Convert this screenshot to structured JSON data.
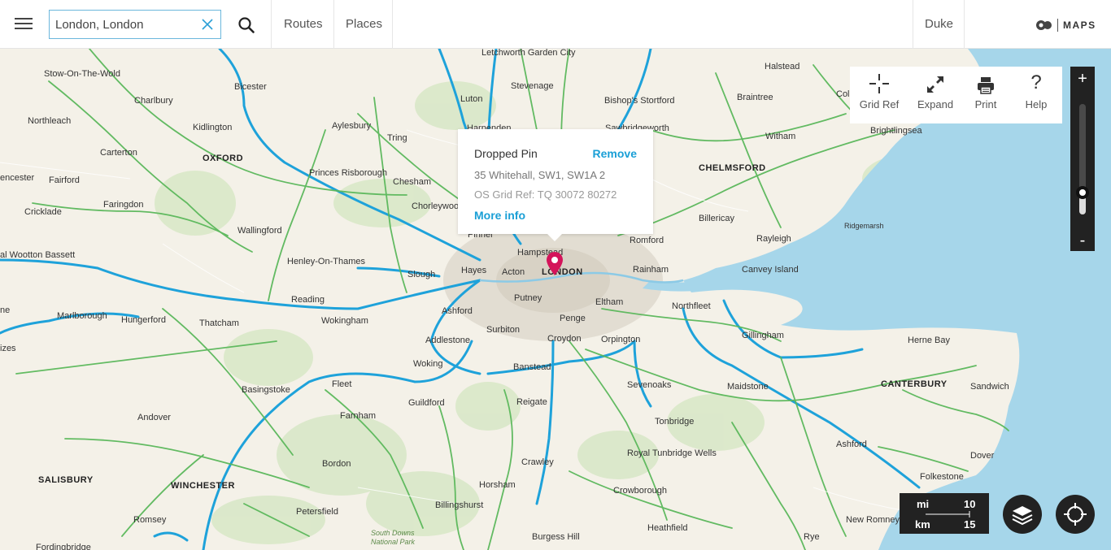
{
  "header": {
    "menu_icon": "hamburger-menu-icon",
    "search": {
      "value": "London, London",
      "clear_icon": "close-icon",
      "search_icon": "search-icon"
    },
    "nav": {
      "routes": "Routes",
      "places": "Places",
      "user": "Duke"
    },
    "logo": {
      "text": "MAPS",
      "icon": "os-logo-icon"
    }
  },
  "tools": [
    {
      "label": "Grid Ref",
      "icon": "crosshair-grid-icon"
    },
    {
      "label": "Expand",
      "icon": "expand-arrows-icon"
    },
    {
      "label": "Print",
      "icon": "printer-icon"
    },
    {
      "label": "Help",
      "icon": "question-mark-icon"
    }
  ],
  "zoom": {
    "in_label": "+",
    "out_label": "-",
    "level": 0.2
  },
  "popup": {
    "title": "Dropped Pin",
    "remove": "Remove",
    "address": "35 Whitehall, SW1, SW1A 2",
    "grid_ref": "OS Grid Ref: TQ 30072 80272",
    "more_info": "More info"
  },
  "scale": {
    "mi_label": "mi",
    "mi_value": "10",
    "km_label": "km",
    "km_value": "15"
  },
  "buttons": {
    "layers_icon": "layers-icon",
    "locate_icon": "locate-crosshair-icon"
  },
  "colors": {
    "accent": "#1a9fd6",
    "pin": "#d4145a",
    "motorway": "#1ea2da",
    "a_road": "#5bb85b",
    "sea": "#a6d6ea",
    "land": "#f4f1e8",
    "panel_dark": "#222222"
  },
  "map": {
    "places": [
      "Letchworth Garden City",
      "Stow-On-The-Wold",
      "Bicester",
      "Halstead",
      "Luton",
      "Stevenage",
      "Charlbury",
      "Bishop's Stortford",
      "Braintree",
      "Northleach",
      "Aylesbury",
      "Harpenden",
      "Sawbridgeworth",
      "Brightlingsea",
      "Kidlington",
      "Tring",
      "Witham",
      "Carterton",
      "OXFORD",
      "CHELMSFORD",
      "encester",
      "Fairford",
      "Princes Risborough",
      "Chesham",
      "Faringdon",
      "Chorleywood",
      "Cricklade",
      "Billericay",
      "Ridgemarsh",
      "Wallingford",
      "Pinner",
      "Romford",
      "Rayleigh",
      "al Wootton Bassett",
      "Hampstead",
      "Henley-On-Thames",
      "Hayes",
      "Acton",
      "LONDON",
      "Rainham",
      "Canvey Island",
      "Slough",
      "Reading",
      "Putney",
      "Eltham",
      "Northfleet",
      "ne",
      "Marlborough",
      "Hungerford",
      "Thatcham",
      "Wokingham",
      "Ashford",
      "Penge",
      "Surbiton",
      "Gillingham",
      "Addlestone",
      "Croydon",
      "Orpington",
      "Herne Bay",
      "izes",
      "Woking",
      "Banstead",
      "Sevenoaks",
      "Maidstone",
      "CANTERBURY",
      "Sandwich",
      "Fleet",
      "Basingstoke",
      "Reigate",
      "Guildford",
      "Farnham",
      "Andover",
      "Tonbridge",
      "Ashford",
      "Crawley",
      "Royal Tunbridge Wells",
      "Dover",
      "Bordon",
      "SALISBURY",
      "WINCHESTER",
      "Horsham",
      "Folkestone",
      "Crowborough",
      "Petersfield",
      "Billingshurst",
      "Romsey",
      "South Downs National Park",
      "Burgess Hill",
      "Heathfield",
      "New Romney",
      "Rye",
      "Fordingbridge",
      "Col"
    ]
  }
}
